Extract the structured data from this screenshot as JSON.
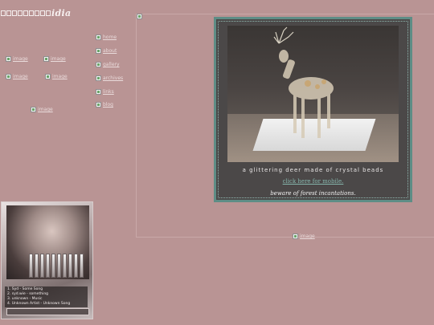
{
  "logo": {
    "suffix": "idia"
  },
  "nav_images": [
    {
      "label": "image"
    },
    {
      "label": "image"
    },
    {
      "label": "image"
    },
    {
      "label": "image"
    }
  ],
  "side_links": [
    {
      "label": "home"
    },
    {
      "label": "about"
    },
    {
      "label": "gallery"
    },
    {
      "label": "archives"
    },
    {
      "label": "links"
    },
    {
      "label": "blog"
    }
  ],
  "small_image": {
    "label": "image"
  },
  "panel": {
    "caption_line": "a glittering deer made of crystal beads",
    "mobile_link": "click here for mobile.",
    "tagline": "beware of forest incantations."
  },
  "bottom_image": {
    "label": "image"
  },
  "player": {
    "tracks": [
      "1. Syd - Some Song",
      "2. syd.wie - something",
      "3. unknown - Music",
      "4. Unknown Artist - Unknown Song"
    ]
  },
  "colors": {
    "background": "#b99494",
    "panel": "#4b4848",
    "panel_border": "#5e8d86",
    "link": "#86b6ad"
  }
}
